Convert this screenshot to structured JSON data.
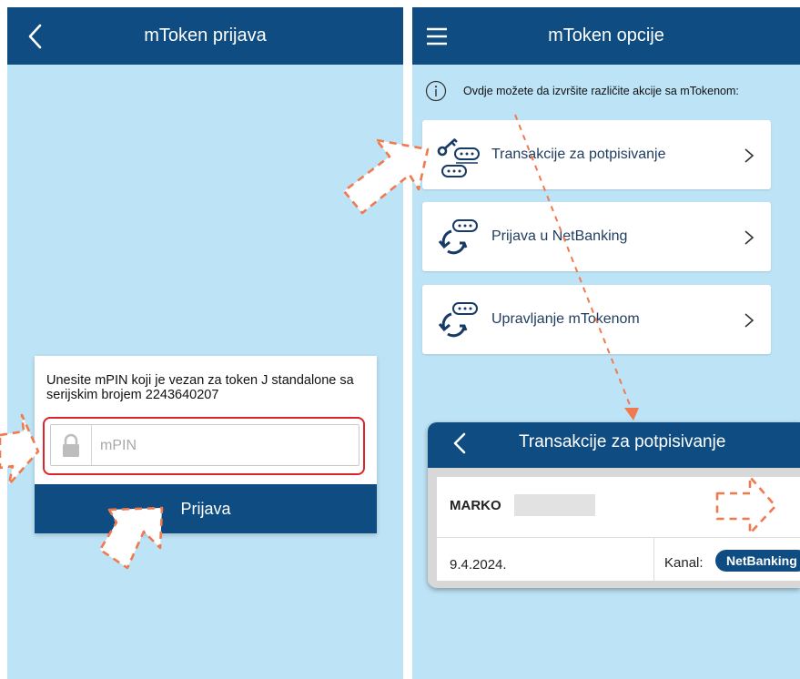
{
  "left_screen": {
    "title": "mToken prijava",
    "login": {
      "message": "Unesite mPIN koji je vezan za token J standalone sa serijskim brojem 2243640207",
      "pin_placeholder": "mPIN",
      "button_label": "Prijava"
    }
  },
  "right_screen": {
    "title": "mToken opcije",
    "info_text": "Ovdje možete da izvršite različite akcije sa mTokenom:",
    "options": [
      {
        "label": "Transakcije  za potpisivanje",
        "icon": "key-token-icon"
      },
      {
        "label": "Prijava u NetBanking",
        "icon": "token-sync-icon"
      },
      {
        "label": "Upravljanje mTokenom",
        "icon": "token-sync-icon"
      }
    ]
  },
  "inset": {
    "title": "Transakcije za potpisivanje",
    "transaction": {
      "name": "MARKO",
      "date": "9.4.2024.",
      "channel_label": "Kanal:",
      "channel_value": "NetBanking"
    }
  },
  "colors": {
    "app_bar": "#0f4c81",
    "background": "#bde3f6",
    "highlight": "#d8262c",
    "annotation_arrow": "#f07a4e"
  }
}
